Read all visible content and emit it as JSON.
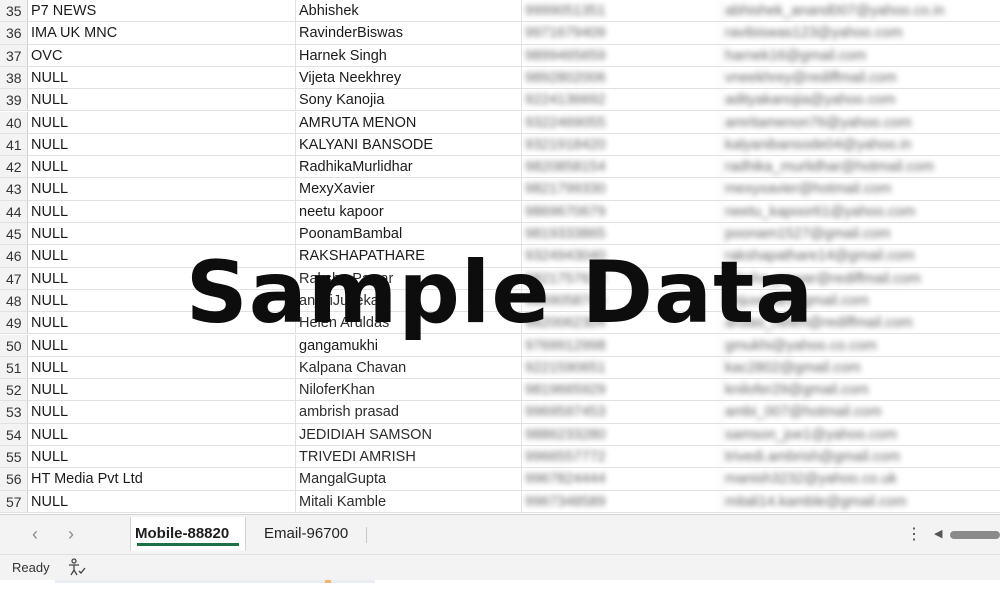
{
  "rows": [
    {
      "num": "35",
      "a": "P7 NEWS",
      "b": "Abhishek",
      "c": "9999051351",
      "d": "abhishek_anand007@yahoo.co.in"
    },
    {
      "num": "36",
      "a": "IMA UK MNC",
      "b": "RavinderBiswas",
      "c": "9971679409",
      "d": "ravibiswas123@yahoo.com"
    },
    {
      "num": "37",
      "a": "OVC",
      "b": "Harnek Singh",
      "c": "9899465659",
      "d": "harnek16@gmail.com"
    },
    {
      "num": "38",
      "a": "NULL",
      "b": "Vijeta Neekhrey",
      "c": "9892802006",
      "d": "vneekhrey@rediffmail.com"
    },
    {
      "num": "39",
      "a": "NULL",
      "b": "Sony Kanojia",
      "c": "9224136692",
      "d": "adityakanojia@yahoo.com"
    },
    {
      "num": "40",
      "a": "NULL",
      "b": "AMRUTA MENON",
      "c": "9322469055",
      "d": "amritamenon76@yahoo.com"
    },
    {
      "num": "41",
      "a": "NULL",
      "b": "KALYANI BANSODE",
      "c": "9321918420",
      "d": "kalyanibansode04@yahoo.in"
    },
    {
      "num": "42",
      "a": "NULL",
      "b": "RadhikaMurlidhar",
      "c": "9820858154",
      "d": "radhika_murlidhar@hotmail.com"
    },
    {
      "num": "43",
      "a": "NULL",
      "b": "MexyXavier",
      "c": "9821799330",
      "d": "mexyxavier@hotmail.com"
    },
    {
      "num": "44",
      "a": "NULL",
      "b": "neetu kapoor",
      "c": "9869670679",
      "d": "neetu_kapoor61@yahoo.com"
    },
    {
      "num": "45",
      "a": "NULL",
      "b": "PoonamBambal",
      "c": "9819333865",
      "d": "poonam1527@gmail.com"
    },
    {
      "num": "46",
      "a": "NULL",
      "b": "RAKSHAPATHARE",
      "c": "9324943040",
      "d": "rakshapathare14@gmail.com"
    },
    {
      "num": "47",
      "a": "NULL",
      "b": "Raksha Pawar",
      "c": "9821757620",
      "d": "raksha_pawar@rediffmail.com"
    },
    {
      "num": "48",
      "a": "NULL",
      "b": "anjaliJuvekar",
      "c": "9869058745",
      "d": "anjuvekar@gmail.com"
    },
    {
      "num": "49",
      "a": "NULL",
      "b": "Helen Aruldas",
      "c": "9820062304",
      "d": "arulas_helen@rediffmail.com"
    },
    {
      "num": "50",
      "a": "NULL",
      "b": "gangamukhi",
      "c": "9769912998",
      "d": "gmukhi@yahoo.co.com"
    },
    {
      "num": "51",
      "a": "NULL",
      "b": "Kalpana Chavan",
      "c": "9221590651",
      "d": "kac2802@gmail.com"
    },
    {
      "num": "52",
      "a": "NULL",
      "b": "NiloferKhan",
      "c": "9819665929",
      "d": "knilofer29@gmail.com"
    },
    {
      "num": "53",
      "a": "NULL",
      "b": "ambrish prasad",
      "c": "9969597453",
      "d": "ambi_007@hotmail.com"
    },
    {
      "num": "54",
      "a": "NULL",
      "b": "JEDIDIAH SAMSON",
      "c": "9886233280",
      "d": "samson_joe1@yahoo.com"
    },
    {
      "num": "55",
      "a": "NULL",
      "b": "TRIVEDI AMRISH",
      "c": "9966557772",
      "d": "trivedi.ambrish@gmail.com"
    },
    {
      "num": "56",
      "a": "HT Media Pvt Ltd",
      "b": "MangalGupta",
      "c": "9967824444",
      "d": "manish3232@yahoo.co.uk"
    },
    {
      "num": "57",
      "a": "NULL",
      "b": "Mitali Kamble",
      "c": "9967348589",
      "d": "mitali14.kamble@gmail.com"
    }
  ],
  "watermark": "Sample Data",
  "sheet_tabs": [
    {
      "label": "Mobile-88820",
      "active": true
    },
    {
      "label": "Email-96700",
      "active": false
    }
  ],
  "status": {
    "text": "Ready"
  },
  "colors": {
    "tab_underline": "#1e7145",
    "grid_line": "#e1e1e1",
    "chrome_bg": "#f3f3f3"
  },
  "icons": {
    "prev_sheet": "chevron-left-icon",
    "next_sheet": "chevron-right-icon",
    "more": "kebab-icon",
    "accessibility": "accessibility-check-icon"
  }
}
